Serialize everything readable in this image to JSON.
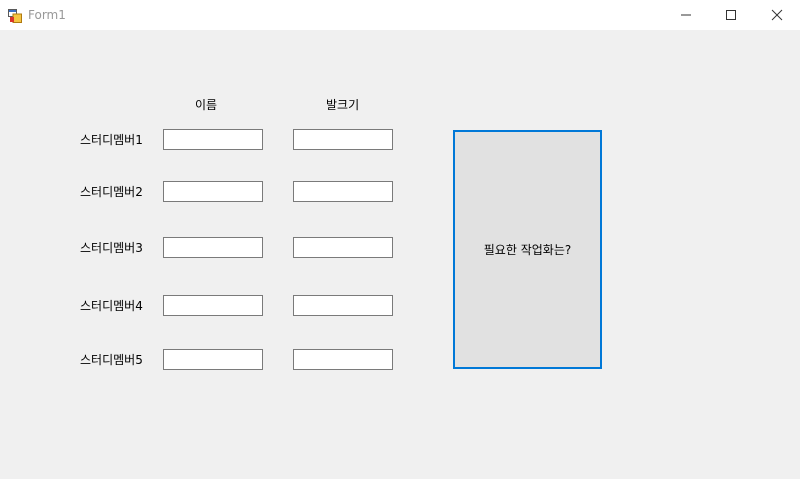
{
  "window": {
    "title": "Form1",
    "icon": "winforms-app-icon",
    "controls": [
      "minimize-icon",
      "maximize-icon",
      "close-icon"
    ]
  },
  "headers": {
    "name": "이름",
    "shoe_size": "발크기"
  },
  "members": [
    {
      "label": "스터디멤버1",
      "name": "",
      "shoe_size": ""
    },
    {
      "label": "스터디멤버2",
      "name": "",
      "shoe_size": ""
    },
    {
      "label": "스터디멤버3",
      "name": "",
      "shoe_size": ""
    },
    {
      "label": "스터디멤버4",
      "name": "",
      "shoe_size": ""
    },
    {
      "label": "스터디멤버5",
      "name": "",
      "shoe_size": ""
    }
  ],
  "action_button": {
    "label": "필요한 작업화는?"
  },
  "colors": {
    "accent": "#0078d7",
    "form_background": "#f0f0f0",
    "button_face": "#e1e1e1"
  }
}
